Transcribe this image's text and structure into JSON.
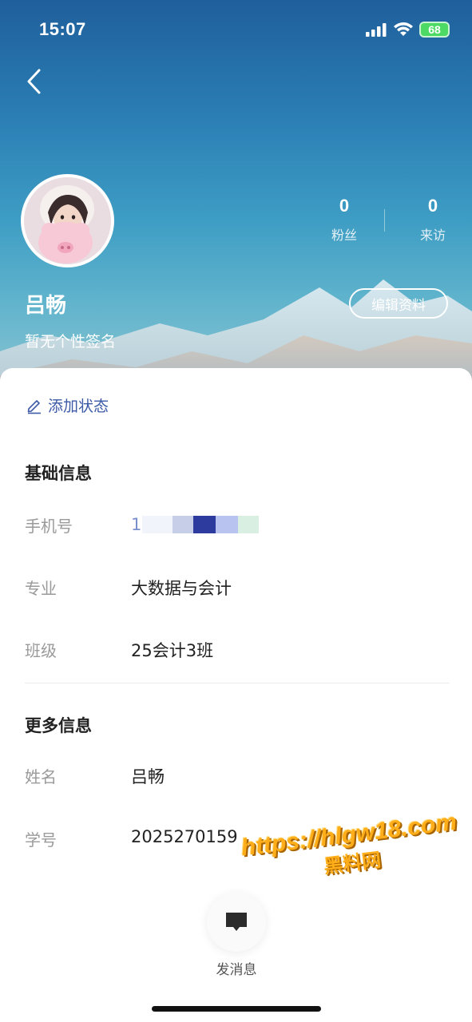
{
  "status_bar": {
    "time": "15:07",
    "battery": "68"
  },
  "profile": {
    "name": "吕畅",
    "signature": "暂无个性签名",
    "edit_button": "编辑资料",
    "stats": [
      {
        "value": "0",
        "label": "粉丝"
      },
      {
        "value": "0",
        "label": "来访"
      }
    ]
  },
  "add_status": "添加状态",
  "basic_info": {
    "title": "基础信息",
    "rows": [
      {
        "label": "手机号",
        "value": "1"
      },
      {
        "label": "专业",
        "value": "大数据与会计"
      },
      {
        "label": "班级",
        "value": "25会计3班"
      }
    ]
  },
  "more_info": {
    "title": "更多信息",
    "rows": [
      {
        "label": "姓名",
        "value": "吕畅"
      },
      {
        "label": "学号",
        "value": "2025270159"
      }
    ]
  },
  "send_message": "发消息",
  "watermark": {
    "line1": "https://hlgw18.com",
    "line2": "黑料网"
  },
  "colors": {
    "accent": "#3c5aa6",
    "battery": "#4cd964",
    "watermark": "#ffae1a"
  }
}
